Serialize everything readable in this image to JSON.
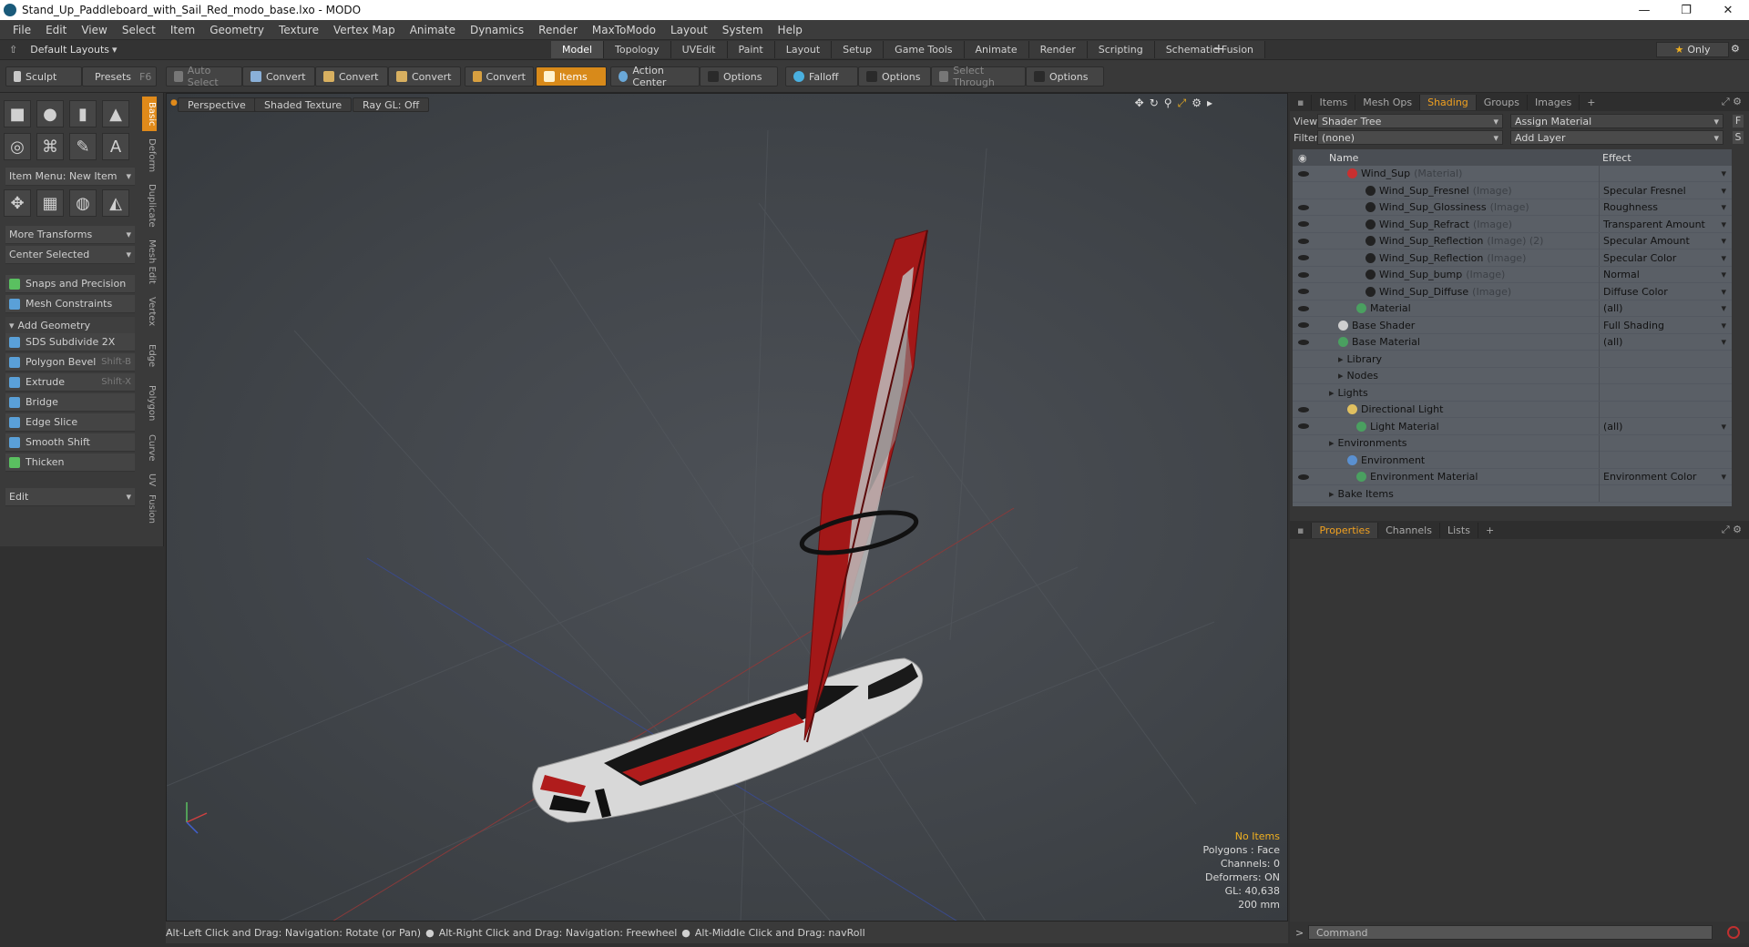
{
  "window": {
    "title": "Stand_Up_Paddleboard_with_Sail_Red_modo_base.lxo - MODO",
    "minimize": "—",
    "maximize": "❐",
    "close": "✕"
  },
  "menu": [
    "File",
    "Edit",
    "View",
    "Select",
    "Item",
    "Geometry",
    "Texture",
    "Vertex Map",
    "Animate",
    "Dynamics",
    "Render",
    "MaxToModo",
    "Layout",
    "System",
    "Help"
  ],
  "layoutbar": {
    "layouts_label": "Default Layouts",
    "tabs": [
      "Model",
      "Topology",
      "UVEdit",
      "Paint",
      "Layout",
      "Setup",
      "Game Tools",
      "Animate",
      "Render",
      "Scripting",
      "Schematic Fusion"
    ],
    "active_tab": "Model",
    "plus": "+",
    "only_label": "Only"
  },
  "toolbar": {
    "sculpt": "Sculpt",
    "presets": "Presets",
    "presets_key": "F6",
    "auto_select": "Auto Select",
    "convert1": "Convert",
    "convert2": "Convert",
    "convert3": "Convert",
    "convert4": "Convert",
    "items": "Items",
    "action_center": "Action Center",
    "options1": "Options",
    "falloff": "Falloff",
    "options2": "Options",
    "select_through": "Select Through",
    "options3": "Options"
  },
  "leftpanel": {
    "item_menu": "Item Menu: New Item",
    "more_transforms": "More Transforms",
    "center_selected": "Center Selected",
    "snaps": "Snaps and Precision",
    "mesh_constraints": "Mesh Constraints",
    "add_geometry": "Add Geometry",
    "tools": [
      {
        "label": "SDS Subdivide 2X",
        "hint": ""
      },
      {
        "label": "Polygon Bevel",
        "hint": "Shift-B"
      },
      {
        "label": "Extrude",
        "hint": "Shift-X"
      },
      {
        "label": "Bridge",
        "hint": ""
      },
      {
        "label": "Edge Slice",
        "hint": ""
      },
      {
        "label": "Smooth Shift",
        "hint": ""
      },
      {
        "label": "Thicken",
        "hint": ""
      }
    ],
    "edit": "Edit",
    "vtabs": [
      "Basic",
      "Deform",
      "Duplicate",
      "Mesh Edit",
      "Vertex",
      "Edge",
      "Polygon",
      "Curve",
      "UV",
      "Fusion"
    ]
  },
  "viewport": {
    "perspective": "Perspective",
    "shaded": "Shaded Texture",
    "raygl": "Ray GL: Off",
    "info": {
      "no_items": "No Items",
      "polygons": "Polygons : Face",
      "channels": "Channels: 0",
      "deformers": "Deformers: ON",
      "gl": "GL: 40,638",
      "size": "200 mm"
    }
  },
  "statusbar": {
    "hint1": "Alt-Left Click and Drag: Navigation: Rotate (or Pan)",
    "hint2": "Alt-Right Click and Drag: Navigation: Freewheel",
    "hint3": "Alt-Middle Click and Drag: navRoll"
  },
  "shaderpanel": {
    "tabs": [
      "Items",
      "Mesh Ops",
      "Shading",
      "Groups",
      "Images"
    ],
    "active_tab": "Shading",
    "plus": "+",
    "view_label": "View",
    "view_value": "Shader Tree",
    "assign_material": "Assign Material",
    "f_key": "F",
    "filter_label": "Filter",
    "filter_value": "(none)",
    "add_layer": "Add Layer",
    "s_key": "S",
    "col_name": "Name",
    "col_effect": "Effect",
    "rows": [
      {
        "name": "Wind_Sup",
        "sub": "(Material)",
        "effect": "",
        "indent": 60,
        "dot": "#c83030",
        "eye": true
      },
      {
        "name": "Wind_Sup_Fresnel",
        "sub": "(Image)",
        "effect": "Specular Fresnel",
        "indent": 80,
        "dot": "#222",
        "eye": false
      },
      {
        "name": "Wind_Sup_Glossiness",
        "sub": "(Image)",
        "effect": "Roughness",
        "indent": 80,
        "dot": "#222",
        "eye": true
      },
      {
        "name": "Wind_Sup_Refract",
        "sub": "(Image)",
        "effect": "Transparent Amount",
        "indent": 80,
        "dot": "#222",
        "eye": true
      },
      {
        "name": "Wind_Sup_Reflection",
        "sub": "(Image) (2)",
        "effect": "Specular Amount",
        "indent": 80,
        "dot": "#222",
        "eye": true
      },
      {
        "name": "Wind_Sup_Reflection",
        "sub": "(Image)",
        "effect": "Specular Color",
        "indent": 80,
        "dot": "#222",
        "eye": true
      },
      {
        "name": "Wind_Sup_bump",
        "sub": "(Image)",
        "effect": "Normal",
        "indent": 80,
        "dot": "#222",
        "eye": true
      },
      {
        "name": "Wind_Sup_Diffuse",
        "sub": "(Image)",
        "effect": "Diffuse Color",
        "indent": 80,
        "dot": "#222",
        "eye": true
      },
      {
        "name": "Material",
        "sub": "",
        "effect": "(all)",
        "indent": 70,
        "dot": "#4aa060",
        "eye": true
      },
      {
        "name": "Base Shader",
        "sub": "",
        "effect": "Full Shading",
        "indent": 50,
        "dot": "#cfcfcf",
        "eye": true
      },
      {
        "name": "Base Material",
        "sub": "",
        "effect": "(all)",
        "indent": 50,
        "dot": "#4aa060",
        "eye": true
      },
      {
        "name": "Library",
        "sub": "",
        "effect": "",
        "indent": 50,
        "dot": "",
        "eye": false
      },
      {
        "name": "Nodes",
        "sub": "",
        "effect": "",
        "indent": 50,
        "dot": "",
        "eye": false
      },
      {
        "name": "Lights",
        "sub": "",
        "effect": "",
        "indent": 40,
        "dot": "",
        "eye": false
      },
      {
        "name": "Directional Light",
        "sub": "",
        "effect": "",
        "indent": 60,
        "dot": "#e0c060",
        "eye": true
      },
      {
        "name": "Light Material",
        "sub": "",
        "effect": "(all)",
        "indent": 70,
        "dot": "#4aa060",
        "eye": true
      },
      {
        "name": "Environments",
        "sub": "",
        "effect": "",
        "indent": 40,
        "dot": "",
        "eye": false
      },
      {
        "name": "Environment",
        "sub": "",
        "effect": "",
        "indent": 60,
        "dot": "#5a90d0",
        "eye": false
      },
      {
        "name": "Environment Material",
        "sub": "",
        "effect": "Environment Color",
        "indent": 70,
        "dot": "#4aa060",
        "eye": true
      },
      {
        "name": "Bake Items",
        "sub": "",
        "effect": "",
        "indent": 40,
        "dot": "",
        "eye": false
      }
    ]
  },
  "propspanel": {
    "tabs": [
      "Properties",
      "Channels",
      "Lists"
    ],
    "active_tab": "Properties",
    "plus": "+"
  },
  "command": {
    "placeholder": "Command"
  },
  "colors": {
    "accent": "#e08a1a",
    "sail_red": "#b01c1c",
    "board_white": "#dcdcdc"
  }
}
